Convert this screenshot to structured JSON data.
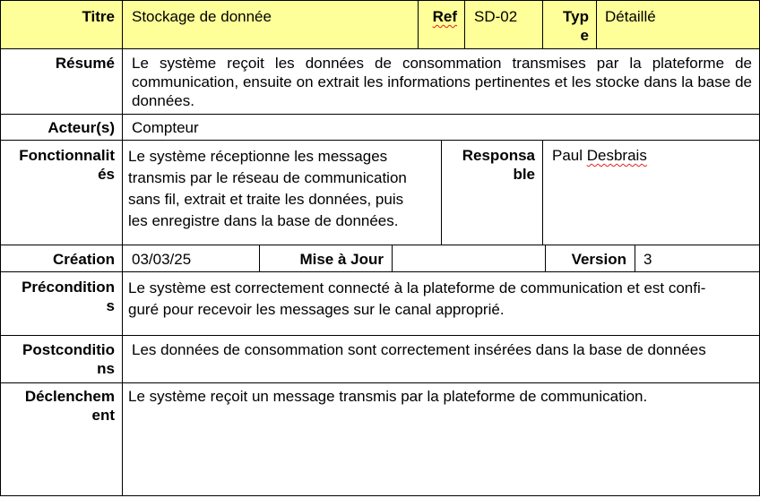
{
  "header": {
    "titre_label": "Titre",
    "titre_value": "Stockage de donnée",
    "ref_label": "Ref",
    "ref_value": "SD-02",
    "type_label_line1": "Typ",
    "type_label_line2": "e",
    "type_value": "Détaillé"
  },
  "resume": {
    "label": "Résumé",
    "value": "Le système reçoit les données de consommation transmises par la plateforme de communication, ensuite on extrait les informations pertinentes et les stocke dans la base de données."
  },
  "acteurs": {
    "label": "Acteur(s)",
    "value": "Compteur"
  },
  "fonctionnalites": {
    "label_line1": "Fonctionnalit",
    "label_line2": "és",
    "lines": [
      "Le système réceptionne les messages",
      "transmis par le réseau de communication",
      "sans fil, extrait et traite les données, puis",
      "les enregistre dans la base de données."
    ],
    "responsable_label_line1": "Responsa",
    "responsable_label_line2": "ble",
    "responsable_first": "Paul ",
    "responsable_last": "Desbrais"
  },
  "creation": {
    "label": "Création",
    "value": "03/03/25",
    "mise_a_jour_label": "Mise à Jour",
    "mise_a_jour_value": "",
    "version_label": "Version",
    "version_value": "3"
  },
  "preconditions": {
    "label_line1": "Précondition",
    "label_line2": "s",
    "line1": "Le système est correctement connecté à la plateforme de communication et est confi-",
    "line2": "guré pour recevoir les messages sur le canal approprié."
  },
  "postconditions": {
    "label_line1": "Postconditio",
    "label_line2": "ns",
    "value": "Les données de consommation sont correctement insérées dans la base de données"
  },
  "declenchement": {
    "label_line1": "Déclenchem",
    "label_line2": "ent",
    "value": "Le système reçoit un message transmis par la plateforme de communication."
  },
  "colors": {
    "header_background": "#ffff99",
    "spell_underline": "#e02020"
  }
}
